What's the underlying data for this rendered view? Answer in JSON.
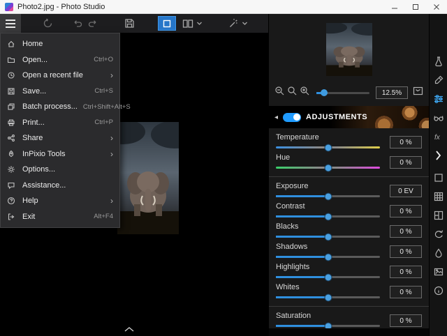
{
  "titlebar": {
    "title": "Photo2.jpg - Photo Studio"
  },
  "menu": {
    "items": [
      {
        "label": "Home",
        "shortcut": ""
      },
      {
        "label": "Open...",
        "shortcut": "Ctrl+O"
      },
      {
        "label": "Open a recent file",
        "shortcut": ""
      },
      {
        "label": "Save...",
        "shortcut": "Ctrl+S"
      },
      {
        "label": "Batch process...",
        "shortcut": "Ctrl+Shift+Alt+S"
      },
      {
        "label": "Print...",
        "shortcut": "Ctrl+P"
      },
      {
        "label": "Share",
        "shortcut": ""
      },
      {
        "label": "InPixio Tools",
        "shortcut": ""
      },
      {
        "label": "Options...",
        "shortcut": ""
      },
      {
        "label": "Assistance...",
        "shortcut": ""
      },
      {
        "label": "Help",
        "shortcut": ""
      },
      {
        "label": "Exit",
        "shortcut": "Alt+F4"
      }
    ]
  },
  "navigator": {
    "zoom_value": "12.5%"
  },
  "adjustments": {
    "title": "ADJUSTMENTS",
    "sliders": [
      {
        "label": "Temperature",
        "value": "0 %"
      },
      {
        "label": "Hue",
        "value": "0 %"
      },
      {
        "label": "Exposure",
        "value": "0 EV"
      },
      {
        "label": "Contrast",
        "value": "0 %"
      },
      {
        "label": "Blacks",
        "value": "0 %"
      },
      {
        "label": "Shadows",
        "value": "0 %"
      },
      {
        "label": "Highlights",
        "value": "0 %"
      },
      {
        "label": "Whites",
        "value": "0 %"
      },
      {
        "label": "Saturation",
        "value": "0 %"
      }
    ]
  },
  "icons": {
    "fx_label": "fx"
  },
  "colors": {
    "accent": "#2676c9",
    "toggle_on": "#1f9bff"
  }
}
